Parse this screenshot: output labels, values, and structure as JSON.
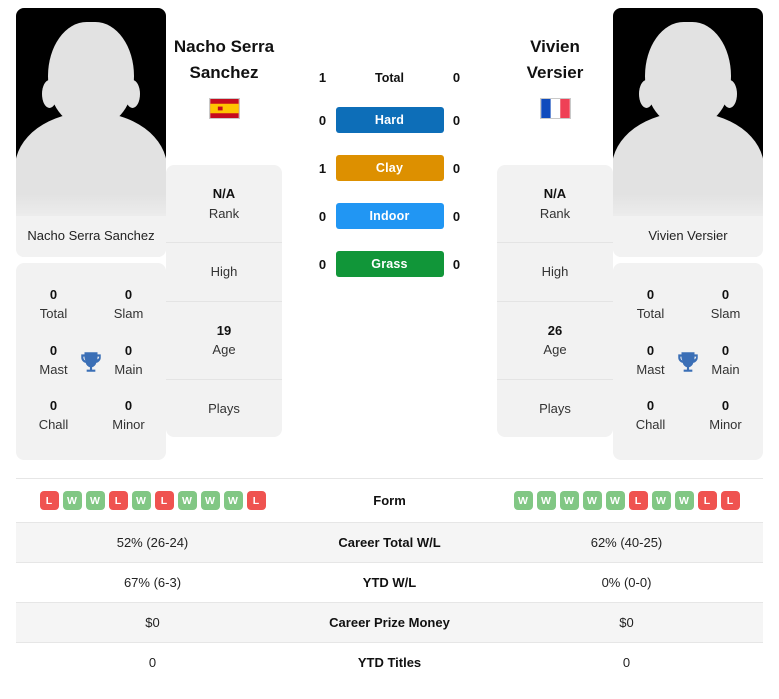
{
  "players": {
    "left": {
      "full_name": "Nacho Serra Sanchez",
      "name_line1": "Nacho Serra",
      "name_line2": "Sanchez",
      "photo_caption": "Nacho Serra Sanchez",
      "country": "Spain",
      "flag_icon": "flag-spain-icon",
      "titles": [
        {
          "num": "0",
          "label": "Total"
        },
        {
          "num": "0",
          "label": "Slam"
        },
        {
          "num": "0",
          "label": "Mast"
        },
        {
          "num": "0",
          "label": "Main"
        },
        {
          "num": "0",
          "label": "Chall"
        },
        {
          "num": "0",
          "label": "Minor"
        }
      ],
      "info": [
        {
          "value": "N/A",
          "label": "Rank"
        },
        {
          "value": "",
          "label": "High"
        },
        {
          "value": "19",
          "label": "Age"
        },
        {
          "value": "",
          "label": "Plays"
        }
      ]
    },
    "right": {
      "full_name": "Vivien Versier",
      "name_line1": "Vivien",
      "name_line2": "Versier",
      "photo_caption": "Vivien Versier",
      "country": "France",
      "flag_icon": "flag-france-icon",
      "titles": [
        {
          "num": "0",
          "label": "Total"
        },
        {
          "num": "0",
          "label": "Slam"
        },
        {
          "num": "0",
          "label": "Mast"
        },
        {
          "num": "0",
          "label": "Main"
        },
        {
          "num": "0",
          "label": "Chall"
        },
        {
          "num": "0",
          "label": "Minor"
        }
      ],
      "info": [
        {
          "value": "N/A",
          "label": "Rank"
        },
        {
          "value": "",
          "label": "High"
        },
        {
          "value": "26",
          "label": "Age"
        },
        {
          "value": "",
          "label": "Plays"
        }
      ]
    }
  },
  "head_to_head": [
    {
      "label": "Total",
      "left": "1",
      "right": "0",
      "style": "plain",
      "color": ""
    },
    {
      "label": "Hard",
      "left": "0",
      "right": "0",
      "style": "pill",
      "color": "#0d6eb8"
    },
    {
      "label": "Clay",
      "left": "1",
      "right": "0",
      "style": "pill",
      "color": "#dd9000"
    },
    {
      "label": "Indoor",
      "left": "0",
      "right": "0",
      "style": "pill",
      "color": "#2196f3"
    },
    {
      "label": "Grass",
      "left": "0",
      "right": "0",
      "style": "pill",
      "color": "#119639"
    }
  ],
  "comparison": {
    "form_label": "Form",
    "left_form": [
      "L",
      "W",
      "W",
      "L",
      "W",
      "L",
      "W",
      "W",
      "W",
      "L"
    ],
    "right_form": [
      "W",
      "W",
      "W",
      "W",
      "W",
      "L",
      "W",
      "W",
      "L",
      "L"
    ],
    "rows": [
      {
        "label": "Career Total W/L",
        "left": "52% (26-24)",
        "right": "62% (40-25)"
      },
      {
        "label": "YTD W/L",
        "left": "67% (6-3)",
        "right": "0% (0-0)"
      },
      {
        "label": "Career Prize Money",
        "left": "$0",
        "right": "$0"
      },
      {
        "label": "YTD Titles",
        "left": "0",
        "right": "0"
      }
    ]
  },
  "colors": {
    "win_badge": "#81c784",
    "loss_badge": "#ef5350",
    "trophy": "#3b6fb6"
  }
}
